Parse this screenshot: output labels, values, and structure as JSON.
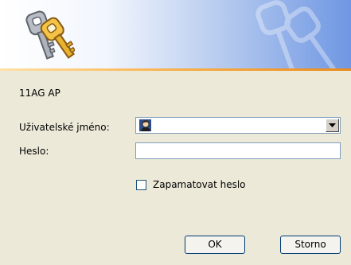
{
  "header": {
    "icon": "keys-icon",
    "watermark_icon": "keys-watermark-icon",
    "gradient_colors": [
      "#ffffff",
      "#6f97e3"
    ],
    "accent_line_color": "#f8b04a"
  },
  "server_name": "11AG AP",
  "form": {
    "username_label": "Uživatelské jméno:",
    "username_value": "",
    "username_icon": "user-icon",
    "password_label": "Heslo:",
    "password_value": "",
    "remember_label": "Zapamatovat heslo",
    "remember_checked": false
  },
  "buttons": {
    "ok_label": "OK",
    "cancel_label": "Storno"
  }
}
